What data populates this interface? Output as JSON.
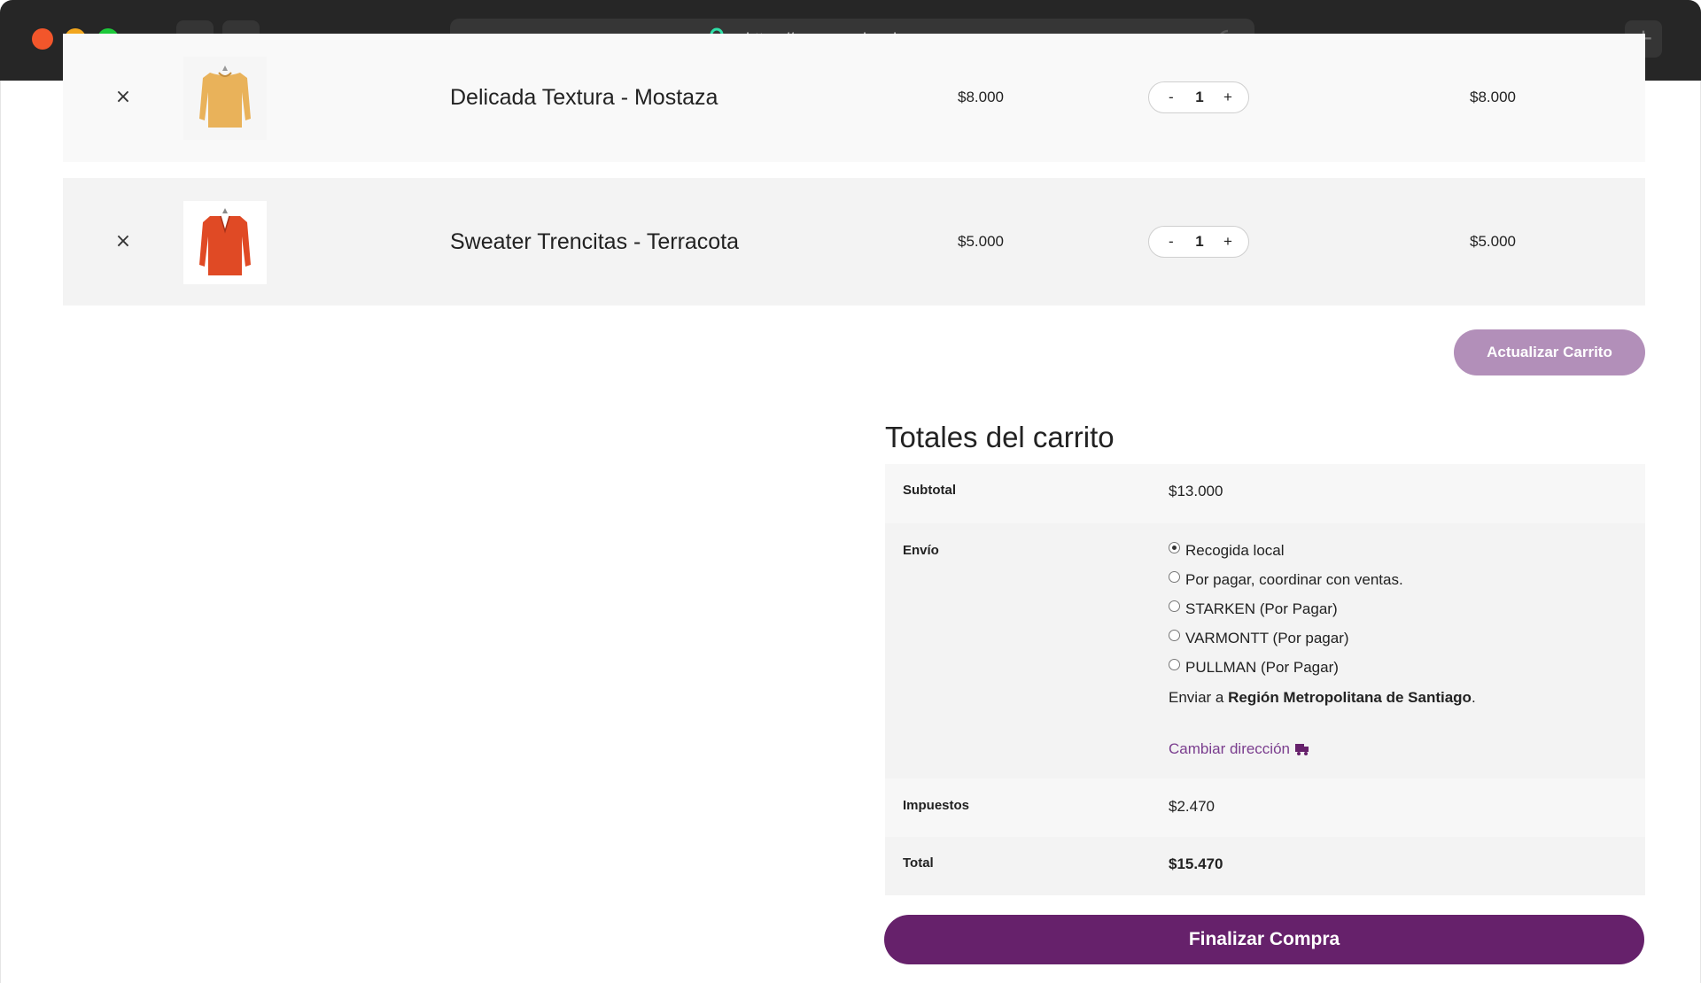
{
  "browser": {
    "url": "https://www.narsha.cl",
    "back_glyph": "‹",
    "forward_glyph": "›",
    "newtab_glyph": "+"
  },
  "cart": {
    "remove_glyph": "×",
    "items": [
      {
        "name": "Delicada Textura - Mostaza",
        "price": "$8.000",
        "qty_minus": "-",
        "qty": "1",
        "qty_plus": "+",
        "subtotal": "$8.000",
        "thumb_color": "#e9b25a"
      },
      {
        "name": "Sweater Trencitas - Terracota",
        "price": "$5.000",
        "qty_minus": "-",
        "qty": "1",
        "qty_plus": "+",
        "subtotal": "$5.000",
        "thumb_color": "#e04a25"
      }
    ],
    "update_label": "Actualizar Carrito"
  },
  "totals": {
    "title": "Totales del carrito",
    "subtotal_label": "Subtotal",
    "subtotal_value": "$13.000",
    "shipping_label": "Envío",
    "shipping_options": [
      {
        "label": "Recogida local",
        "selected": true
      },
      {
        "label": "Por pagar, coordinar con ventas.",
        "selected": false
      },
      {
        "label": "STARKEN (Por Pagar)",
        "selected": false
      },
      {
        "label": "VARMONTT (Por pagar)",
        "selected": false
      },
      {
        "label": "PULLMAN (Por Pagar)",
        "selected": false
      }
    ],
    "ship_to_prefix": "Enviar a ",
    "ship_to_region": "Región Metropolitana de Santiago",
    "ship_to_suffix": ".",
    "change_address": "Cambiar dirección",
    "tax_label": "Impuestos",
    "tax_value": "$2.470",
    "total_label": "Total",
    "total_value": "$15.470",
    "checkout_label": "Finalizar Compra"
  },
  "colors": {
    "accent": "#66216b",
    "accent_light": "#b28fb9",
    "link": "#7a3d8e",
    "lock": "#2fe0a8"
  }
}
